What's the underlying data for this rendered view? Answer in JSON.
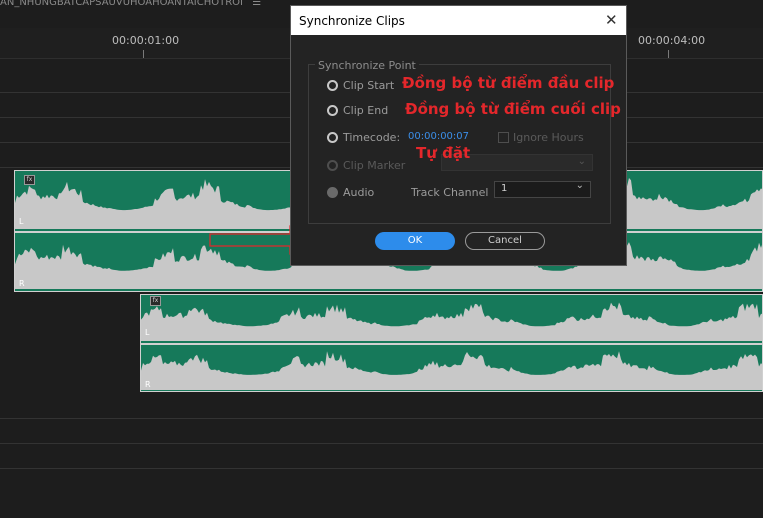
{
  "timeline": {
    "sequence_name": "AN_NHUNGBATCAPSAUVUHOAHOANTAICHOTROI",
    "menu_icon": "hamburger-icon",
    "timecodes": [
      "00:00:01:00",
      "00:00:04:00"
    ],
    "clips": {
      "channel_left": "L",
      "channel_right": "R",
      "fx_label": "fx"
    },
    "clip_color": "#16795a"
  },
  "dialog": {
    "title": "Synchronize Clips",
    "close_icon": "close-icon",
    "group_label": "Synchronize Point",
    "options": {
      "clip_start": "Clip Start",
      "clip_end": "Clip End",
      "timecode": "Timecode:",
      "timecode_value": "00:00:00:07",
      "ignore_hours": "Ignore Hours",
      "clip_marker": "Clip Marker",
      "audio": "Audio",
      "track_channel": "Track Channel",
      "track_channel_value": "1"
    },
    "buttons": {
      "ok": "OK",
      "cancel": "Cancel"
    },
    "accent_color": "#2d8ceb"
  },
  "annotations": {
    "clip_start_note": "Đồng bộ từ điểm đầu clip",
    "clip_end_note": "Đồng bộ từ điểm cuối clip",
    "timecode_note": "Tự đặt",
    "color": "#e4272b"
  }
}
